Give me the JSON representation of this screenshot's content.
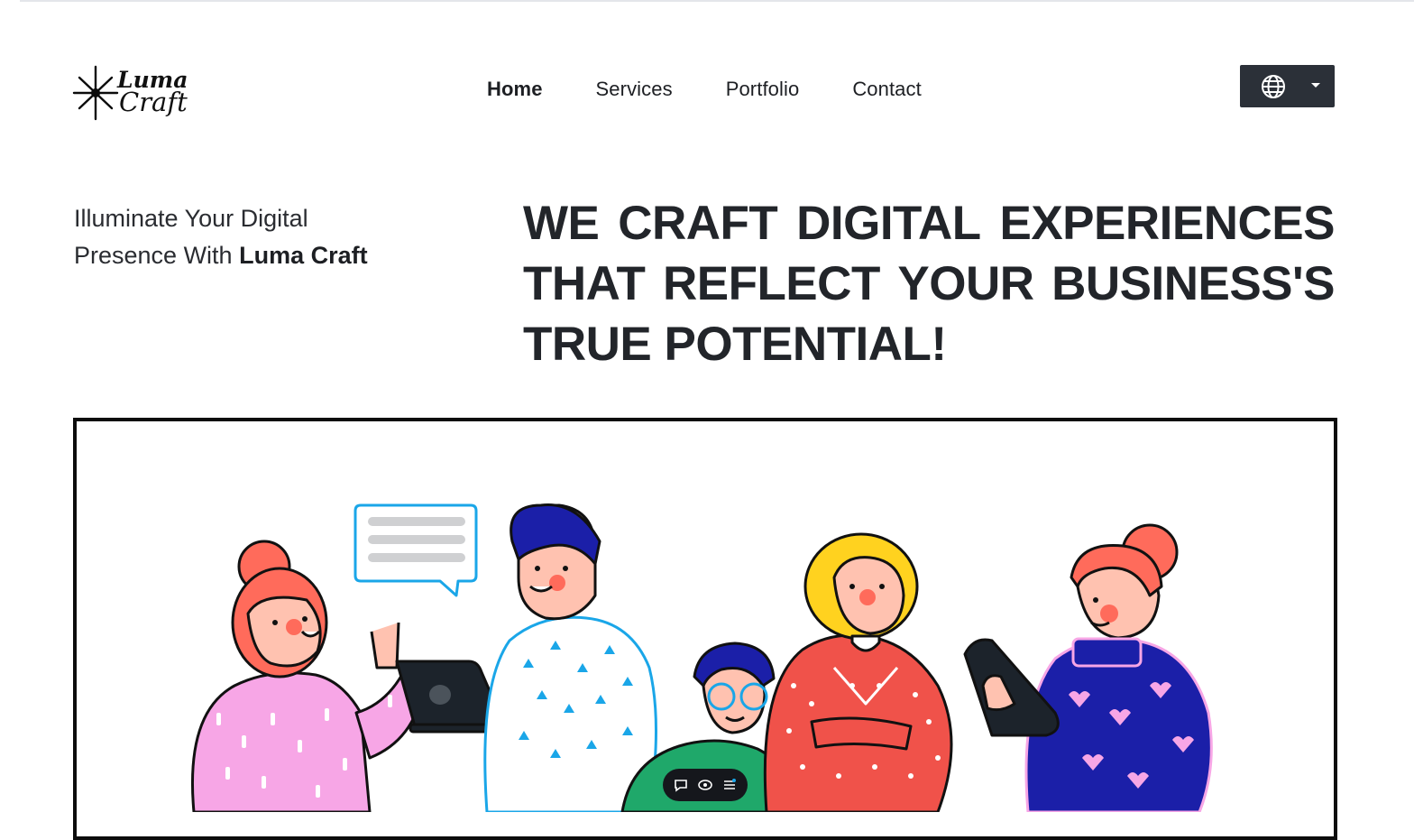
{
  "brand": {
    "logo_line1": "Luma",
    "logo_line2": "Craft",
    "logo_icon": "starburst-icon"
  },
  "nav": {
    "items": [
      {
        "label": "Home",
        "active": true
      },
      {
        "label": "Services",
        "active": false
      },
      {
        "label": "Portfolio",
        "active": false
      },
      {
        "label": "Contact",
        "active": false
      }
    ]
  },
  "language_selector": {
    "icon": "globe-icon",
    "caret_icon": "caret-down-icon"
  },
  "hero": {
    "tagline_line1": "Illuminate Your Digital",
    "tagline_line2_prefix": "Presence With ",
    "tagline_line2_bold": "Luma Craft",
    "headline_lines": [
      [
        "WE",
        "CRAFT",
        "DIGITAL",
        "EXPERIENCES"
      ],
      [
        "THAT",
        "REFLECT",
        "YOUR",
        "BUSINESS'S"
      ],
      [
        "TRUE",
        "POTENTIAL!"
      ]
    ]
  },
  "illustration_toolbar": {
    "icons": [
      "comment-icon",
      "eye-icon",
      "list-icon"
    ]
  },
  "colors": {
    "accent_dark": "#2b3038",
    "text": "#22252a",
    "coral": "#ff6b5b",
    "pink": "#f7a6e6",
    "blue": "#1b1fa8",
    "cyan": "#1aa6e8",
    "yellow": "#ffd21f",
    "red": "#f0524a",
    "green": "#1fa86a"
  }
}
